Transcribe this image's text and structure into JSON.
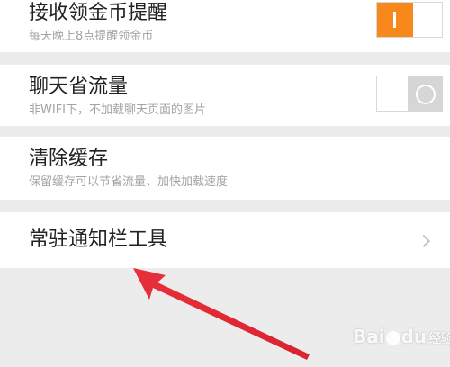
{
  "settings": [
    {
      "title": "接收领金币提醒",
      "subtitle": "每天晚上8点提醒领金币",
      "control": "toggle",
      "toggle_on": true
    },
    {
      "title": "聊天省流量",
      "subtitle": "非WIFI下，不加载聊天页面的图片",
      "control": "toggle",
      "toggle_on": false
    },
    {
      "title": "清除缓存",
      "subtitle": "保留缓存可以节省流量、加快加载速度",
      "control": "none"
    },
    {
      "title": "常驻通知栏工具",
      "control": "chevron"
    }
  ],
  "colors": {
    "accent": "#f7891c",
    "annotation_arrow": "#e8303a",
    "background": "#ececec"
  },
  "watermark": {
    "brand_left": "Bai",
    "brand_right": "经验",
    "brand_mid": "du"
  }
}
